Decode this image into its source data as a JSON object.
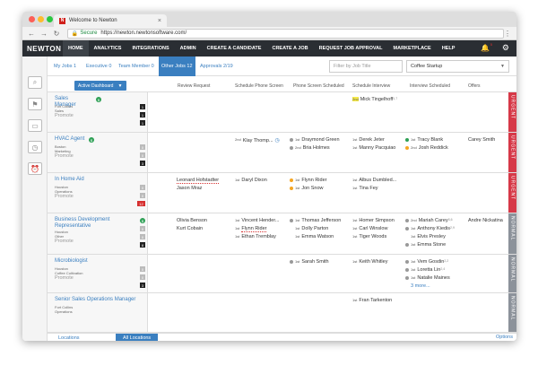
{
  "browser": {
    "tab_title": "Welcome to Newton",
    "favicon": "N",
    "close": "×",
    "secure_label": "Secure",
    "url": "https://newton.newtonsoftware.com/"
  },
  "nav": {
    "logo": "NEWTON",
    "items": [
      "HOME",
      "ANALYTICS",
      "INTEGRATIONS",
      "ADMIN",
      "CREATE A CANDIDATE",
      "CREATE A JOB",
      "REQUEST JOB APPROVAL",
      "MARKETPLACE",
      "HELP"
    ],
    "notifications": "5"
  },
  "filters": {
    "tabs": [
      "My Jobs 1",
      "Executive 0",
      "Team Member 0",
      "Other Jobs 12",
      "Approvals 2/19"
    ],
    "job_title_placeholder": "Filter by Job Title",
    "company": "Coffee Startup"
  },
  "header": {
    "dashboard_button": "Active Dashboard",
    "columns": [
      "Review Request",
      "Schedule Phone Screen",
      "Phone Screen Scheduled",
      "Schedule Interview",
      "Interview Scheduled",
      "Offers"
    ]
  },
  "rows": [
    {
      "title": "Sales Manager",
      "info": [
        "Fort Collins",
        "Sales",
        "Promote"
      ],
      "counts": [
        "1",
        "1",
        "1"
      ],
      "status": "URGENT",
      "cells": {
        "schedule_interview": [
          {
            "pos": "2nd",
            "name": "Mick Tingelhoff",
            "sup": "1,7"
          }
        ]
      }
    },
    {
      "title": "HVAC Agent",
      "info": [
        "Boston",
        "Marketing",
        "Promote"
      ],
      "counts": [
        "0",
        "0",
        "3"
      ],
      "status": "URGENT",
      "cells": {
        "schedule_phone": [
          {
            "pos": "2nd",
            "name": "Klay Thomp..."
          }
        ],
        "phone_scheduled": [
          {
            "pos": "1st",
            "name": "Draymond Green"
          },
          {
            "pos": "2nd",
            "name": "Bria Holmes"
          }
        ],
        "schedule_interview": [
          {
            "pos": "1st",
            "name": "Derek Jeter"
          },
          {
            "pos": "1st",
            "name": "Manny Pacquiao"
          }
        ],
        "interview_scheduled": [
          {
            "pos": "1st",
            "name": "Tracy Blank"
          },
          {
            "pos": "2nd",
            "name": "Josh Reddick"
          }
        ],
        "offers": [
          "Carey Smith"
        ]
      }
    },
    {
      "title": "In Home Aid",
      "info": [
        "Houston",
        "Operations",
        "Promote"
      ],
      "counts": [
        "0",
        "0",
        "12"
      ],
      "status": "URGENT",
      "cells": {
        "review": [
          "Leonard Hofstadter",
          "Jason Mraz"
        ],
        "schedule_phone": [
          {
            "pos": "1st",
            "name": "Daryl Dixon"
          }
        ],
        "phone_scheduled": [
          {
            "pos": "1st",
            "name": "Flynn Rider"
          },
          {
            "pos": "1st",
            "name": "Jon Snow"
          }
        ],
        "schedule_interview": [
          {
            "pos": "1st",
            "name": "Albus Dumbled..."
          },
          {
            "pos": "1st",
            "name": "Tina Fey"
          }
        ]
      }
    },
    {
      "title": "Business Development Representative",
      "info": [
        "Houston",
        "Other",
        "Promote"
      ],
      "counts": [
        "0",
        "0",
        "8"
      ],
      "status": "NORMAL",
      "cells": {
        "review": [
          "Olivia Benson",
          "Kurt Cobain"
        ],
        "schedule_phone": [
          {
            "pos": "1st",
            "name": "Vincent Hender..."
          },
          {
            "pos": "1st",
            "name": "Flynn Rider"
          },
          {
            "pos": "1st",
            "name": "Ethan Tremblay"
          }
        ],
        "phone_scheduled": [
          {
            "pos": "1st",
            "name": "Thomas Jefferson"
          },
          {
            "pos": "1st",
            "name": "Dolly Parton"
          },
          {
            "pos": "1st",
            "name": "Emma Watson"
          }
        ],
        "schedule_interview": [
          {
            "pos": "1st",
            "name": "Homer Simpson"
          },
          {
            "pos": "1st",
            "name": "Carl Winslow"
          },
          {
            "pos": "1st",
            "name": "Tiger Woods"
          }
        ],
        "interview_scheduled": [
          {
            "pos": "2nd",
            "name": "Mariah Carey",
            "sup": "3,6"
          },
          {
            "pos": "1st",
            "name": "Anthony Kiedis",
            "sup": "2,9"
          },
          {
            "pos": "1st",
            "name": "Elvis Presley"
          },
          {
            "pos": "1st",
            "name": "Emma Stone"
          }
        ],
        "offers": [
          "Andre Nickatina"
        ]
      }
    },
    {
      "title": "Microbiologist",
      "info": [
        "Houston",
        "Coffee Cultivation",
        "Promote"
      ],
      "counts": [
        "0",
        "0",
        "3"
      ],
      "status": "NORMAL",
      "cells": {
        "phone_scheduled": [
          {
            "pos": "1st",
            "name": "Sarah Smith"
          }
        ],
        "schedule_interview": [
          {
            "pos": "1st",
            "name": "Keith Whitley"
          }
        ],
        "interview_scheduled": [
          {
            "pos": "1st",
            "name": "Vem Gosdin",
            "sup": "2,2"
          },
          {
            "pos": "1st",
            "name": "Loretta Lin",
            "sup": "2,4"
          },
          {
            "pos": "1st",
            "name": "Natalie Maines"
          }
        ],
        "more": "3 more..."
      }
    },
    {
      "title": "Senior Sales Operations Manager",
      "info": [
        "Fort Collins",
        "Operations"
      ],
      "status": "NORMAL",
      "cells": {
        "schedule_interview": [
          {
            "pos": "1st",
            "name": "Fran Tarkenton"
          }
        ]
      }
    }
  ],
  "bottom": {
    "tabs": [
      "Locations",
      "All Locations"
    ],
    "options": "Options"
  },
  "colors": {
    "brand_nav": "#2a2e33",
    "accent": "#3a7fc0",
    "urgent": "#d63847",
    "normal": "#8c929a"
  }
}
